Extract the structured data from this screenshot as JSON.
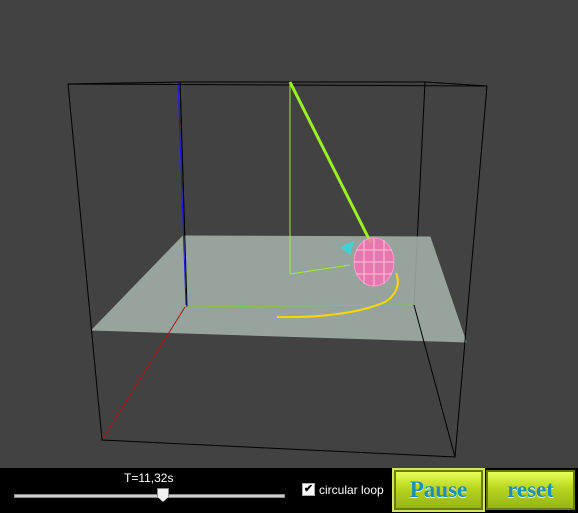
{
  "scene": {
    "background": "#424242",
    "box_edge_color": "#000000",
    "floor_color": "#a6b4ad",
    "string_color": "#9bf026",
    "path_color": "#ffd600",
    "bob_color": "#ff69b4",
    "axis_colors": {
      "x": "#b21010",
      "y": "#1a1ae0",
      "z": "#86c844"
    }
  },
  "controls": {
    "time_label": "T=11,32s",
    "slider_fraction": 0.55,
    "loop_checkbox": {
      "checked": true,
      "label": "circular loop"
    },
    "pause_label": "Pause",
    "reset_label": "reset"
  }
}
